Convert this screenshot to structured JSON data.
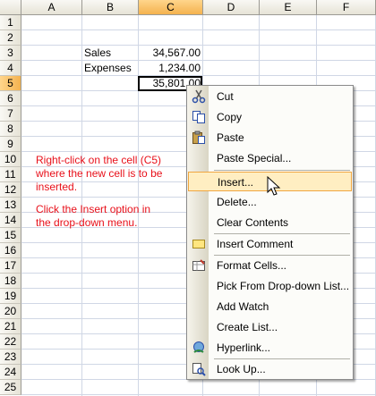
{
  "columns": [
    "A",
    "B",
    "C",
    "D",
    "E",
    "F"
  ],
  "selected_column": "C",
  "rows": [
    "1",
    "2",
    "3",
    "4",
    "5",
    "6",
    "7",
    "8",
    "9",
    "10",
    "11",
    "12",
    "13",
    "14",
    "15",
    "16",
    "17",
    "18",
    "19",
    "20",
    "21",
    "22",
    "23",
    "24",
    "25"
  ],
  "selected_row": "5",
  "cells": {
    "b3": "Sales",
    "c3": "34,567.00",
    "b4": "Expenses",
    "c4": "1,234.00",
    "c5": "35,801.00"
  },
  "note": {
    "line1": "Right-click on the cell (C5)",
    "line2": "where the new cell is to be",
    "line3": "inserted.",
    "line4": "Click the Insert option in",
    "line5": "the drop-down menu."
  },
  "menu": {
    "items": [
      {
        "label": "Cut",
        "icon": "scissors-icon"
      },
      {
        "label": "Copy",
        "icon": "copy-icon"
      },
      {
        "label": "Paste",
        "icon": "paste-icon"
      },
      {
        "label": "Paste Special...",
        "icon": ""
      },
      {
        "label": "Insert...",
        "icon": "",
        "highlighted": true
      },
      {
        "label": "Delete...",
        "icon": ""
      },
      {
        "label": "Clear Contents",
        "icon": ""
      },
      {
        "label": "Insert Comment",
        "icon": "comment-icon"
      },
      {
        "label": "Format Cells...",
        "icon": "format-cells-icon"
      },
      {
        "label": "Pick From Drop-down List...",
        "icon": ""
      },
      {
        "label": "Add Watch",
        "icon": ""
      },
      {
        "label": "Create List...",
        "icon": ""
      },
      {
        "label": "Hyperlink...",
        "icon": "hyperlink-icon"
      },
      {
        "label": "Look Up...",
        "icon": "lookup-icon"
      }
    ]
  },
  "colors": {
    "note_text": "#e8101a",
    "highlight_bg": "#ffeec2",
    "highlight_border": "#f0a640",
    "header_selected": "#f4b24e"
  }
}
